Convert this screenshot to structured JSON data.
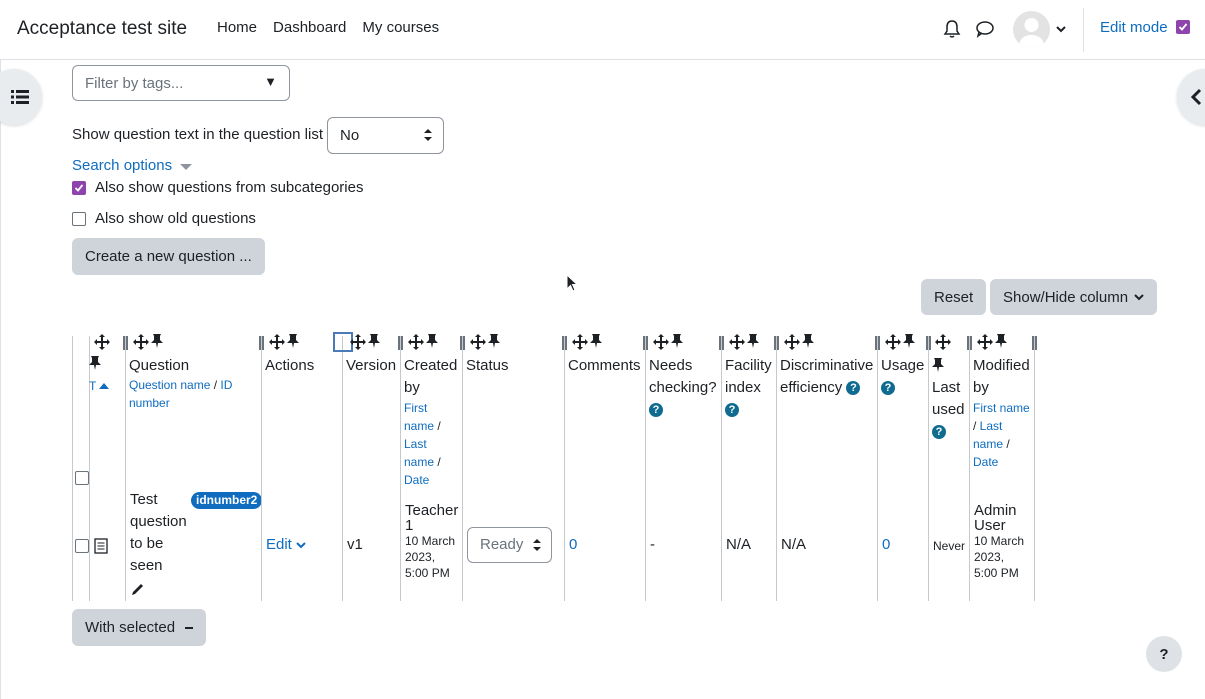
{
  "navbar": {
    "site_name": "Acceptance test site",
    "links": [
      "Home",
      "Dashboard",
      "My courses"
    ],
    "edit_mode_label": "Edit mode"
  },
  "filters": {
    "tag_placeholder": "Filter by tags...",
    "question_text_label": "Show question text in the question list",
    "question_text_value": "No",
    "search_options_label": "Search options",
    "subcategories_label": "Also show questions from subcategories",
    "subcategories_checked": true,
    "old_questions_label": "Also show old questions",
    "old_questions_checked": false
  },
  "buttons": {
    "create": "Create a new question ...",
    "reset": "Reset",
    "show_hide": "Show/Hide column",
    "with_selected": "With selected"
  },
  "table": {
    "type_sort_label": "T",
    "headers": {
      "question": "Question",
      "question_sort_1": "Question name",
      "question_sort_2": "ID number",
      "actions": "Actions",
      "version": "Version",
      "created_by_1": "Created",
      "created_by_2": "by",
      "created_sort_1": "First",
      "created_sort_2": "name",
      "created_sort_3": "Last",
      "created_sort_4": "name",
      "created_sort_5": "Date",
      "status": "Status",
      "comments": "Comments",
      "needs_1": "Needs",
      "needs_2": "checking?",
      "facility_1": "Facility",
      "facility_2": "index",
      "discrim_1": "Discriminative",
      "discrim_2": "efficiency",
      "usage": "Usage",
      "last_used_1": "Last",
      "last_used_2": "used",
      "modified_1": "Modified",
      "modified_2": "by",
      "modified_sort_1": "First name",
      "modified_sort_2": "Last",
      "modified_sort_3": "name",
      "modified_sort_4": "Date"
    },
    "row": {
      "question_lines": [
        "Test",
        "question",
        "to be",
        "seen"
      ],
      "id_number": "idnumber2",
      "action": "Edit",
      "version": "v1",
      "created_by_name_1": "Teacher",
      "created_by_name_2": "1",
      "created_date_1": "10 March",
      "created_date_2": "2023,",
      "created_date_3": "5:00 PM",
      "status": "Ready",
      "comments": "0",
      "needs_checking": "-",
      "facility_index": "N/A",
      "discriminative_efficiency": "N/A",
      "usage": "0",
      "last_used": "Never",
      "modified_by_name_1": "Admin",
      "modified_by_name_2": "User",
      "modified_date_1": "10 March",
      "modified_date_2": "2023,",
      "modified_date_3": "5:00 PM"
    }
  },
  "help_button": "?",
  "colors": {
    "link": "#0f6cbf",
    "checkbox_accent": "#8e44ad",
    "help_icon": "#0f6b8f",
    "button_bg": "#ced4da"
  }
}
